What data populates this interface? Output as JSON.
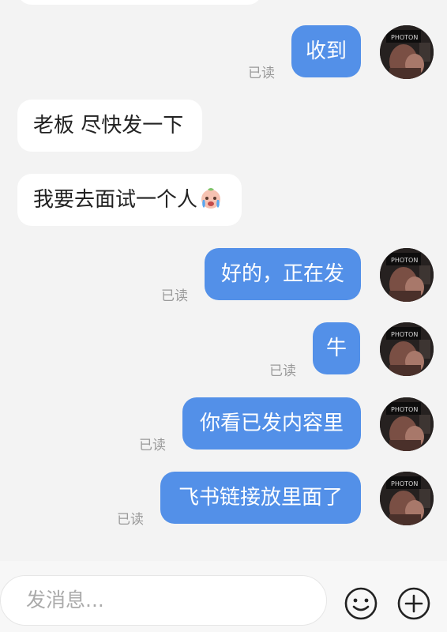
{
  "messages": [
    {
      "side": "out",
      "text": "收到",
      "status": "已读"
    },
    {
      "side": "in",
      "text": "老板 尽快发一下"
    },
    {
      "side": "in",
      "text": "我要去面试一个人",
      "emoji": "crying-face-emoji"
    },
    {
      "side": "out",
      "text": "好的，正在发",
      "status": "已读"
    },
    {
      "side": "out",
      "text": "牛",
      "status": "已读"
    },
    {
      "side": "out",
      "text": "你看已发内容里",
      "status": "已读"
    },
    {
      "side": "out",
      "text": "飞书链接放里面了",
      "status": "已读"
    }
  ],
  "composer": {
    "placeholder": "发消息...",
    "emoji_icon": "smiley-face-icon",
    "plus_icon": "plus-circle-icon"
  },
  "colors": {
    "background": "#f3f3f3",
    "outgoing_bubble": "#5390e8",
    "incoming_bubble": "#ffffff",
    "read_status": "#9a9a9a"
  }
}
